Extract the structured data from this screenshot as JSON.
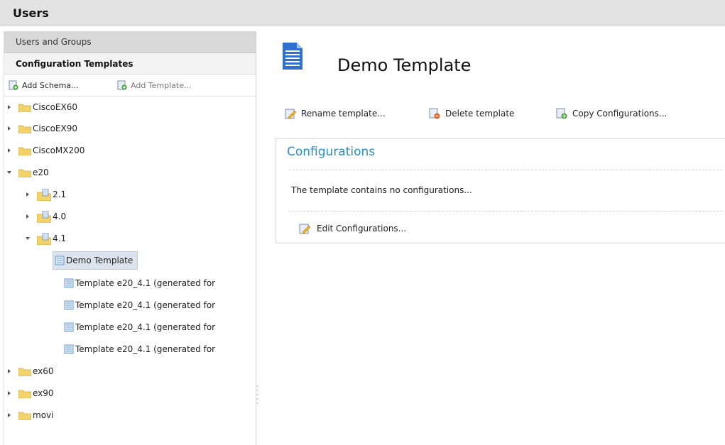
{
  "header": {
    "title": "Users"
  },
  "left": {
    "accordion_users": "Users and Groups",
    "accordion_config": "Configuration Templates",
    "toolbar": {
      "add_schema": "Add Schema...",
      "add_template": "Add Template..."
    },
    "tree": {
      "cisco_ex60": "CiscoEX60",
      "cisco_ex90": "CiscoEX90",
      "cisco_mx200": "CiscoMX200",
      "e20": "e20",
      "v21": "2.1",
      "v40": "4.0",
      "v41": "4.1",
      "demo_template": "Demo Template",
      "templates": [
        "Template e20_4.1 (generated for",
        "Template e20_4.1 (generated for",
        "Template e20_4.1 (generated for",
        "Template e20_4.1 (generated for"
      ],
      "ex60": "ex60",
      "ex90": "ex90",
      "movi": "movi"
    }
  },
  "main": {
    "title": "Demo Template",
    "actions": {
      "rename": "Rename template...",
      "delete": "Delete template",
      "copy": "Copy Configurations..."
    },
    "configurations": {
      "heading": "Configurations",
      "empty_text": "The template contains no configurations...",
      "edit": "Edit Configurations..."
    }
  },
  "colors": {
    "accent": "#2a8ec9",
    "folder": "#f2d36b",
    "header_bg": "#e3e3e3",
    "selected_bg": "#dbe4ee"
  }
}
